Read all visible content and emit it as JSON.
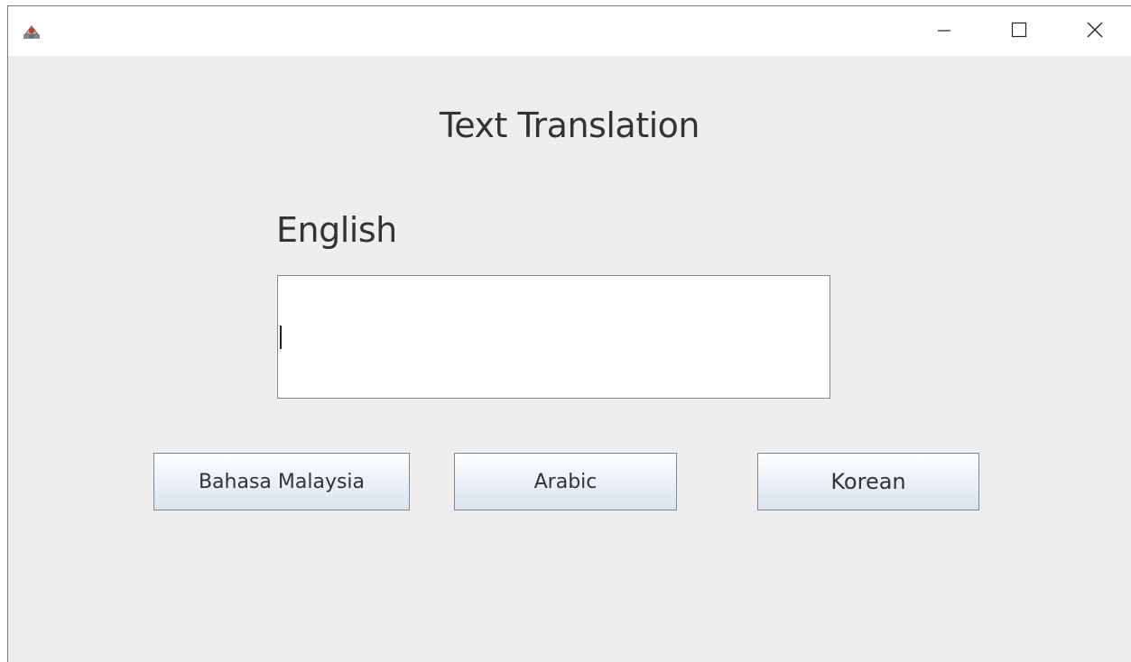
{
  "window": {
    "controls": {
      "minimize_icon": "minimize-icon",
      "maximize_icon": "maximize-icon",
      "close_icon": "close-icon"
    }
  },
  "main": {
    "title": "Text Translation",
    "source_label": "English",
    "input": {
      "value": ""
    },
    "buttons": [
      {
        "label": "Bahasa Malaysia"
      },
      {
        "label": "Arabic"
      },
      {
        "label": "Korean"
      }
    ]
  }
}
